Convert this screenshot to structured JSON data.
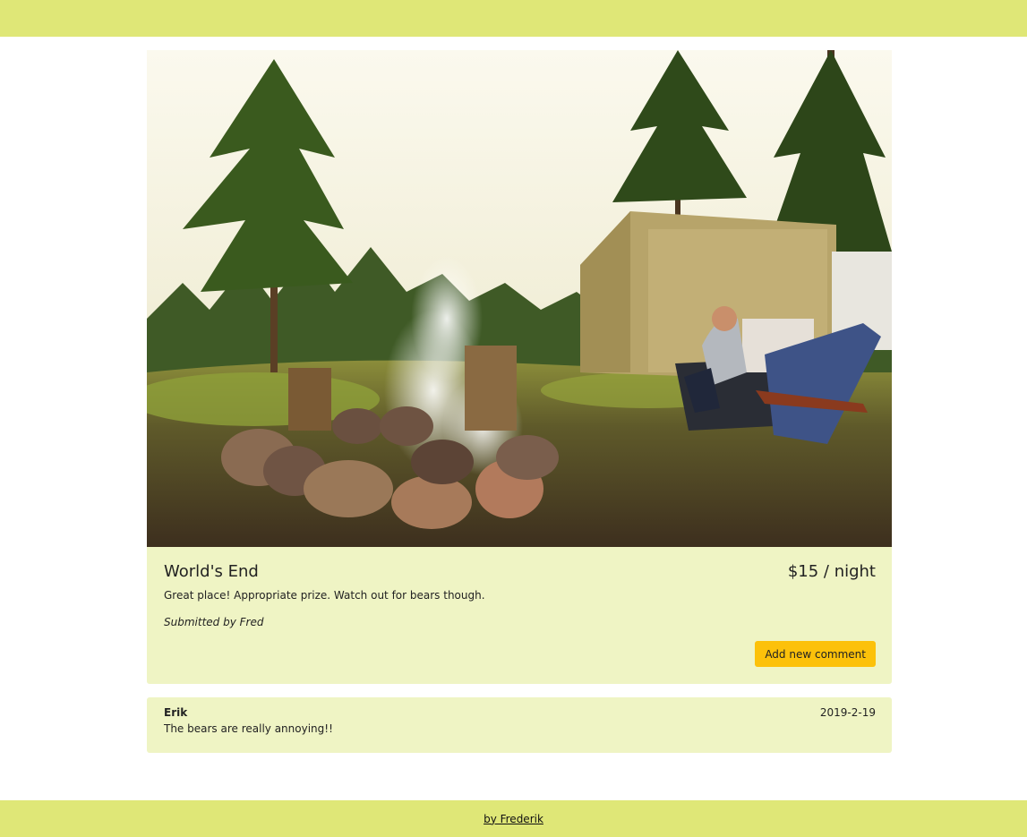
{
  "campground": {
    "name": "World's End",
    "price": "$15 / night",
    "description": "Great place! Appropriate prize. Watch out for bears though.",
    "submitted_by": "Submitted by Fred",
    "add_comment_label": "Add new comment"
  },
  "comments": [
    {
      "author": "Erik",
      "date": "2019-2-19",
      "text": "The bears are really annoying!!"
    }
  ],
  "footer": {
    "link_text": "by Frederik"
  },
  "colors": {
    "header_footer_bg": "#dfe777",
    "card_bg": "#eff4c4",
    "button_bg": "#fcc10a"
  }
}
